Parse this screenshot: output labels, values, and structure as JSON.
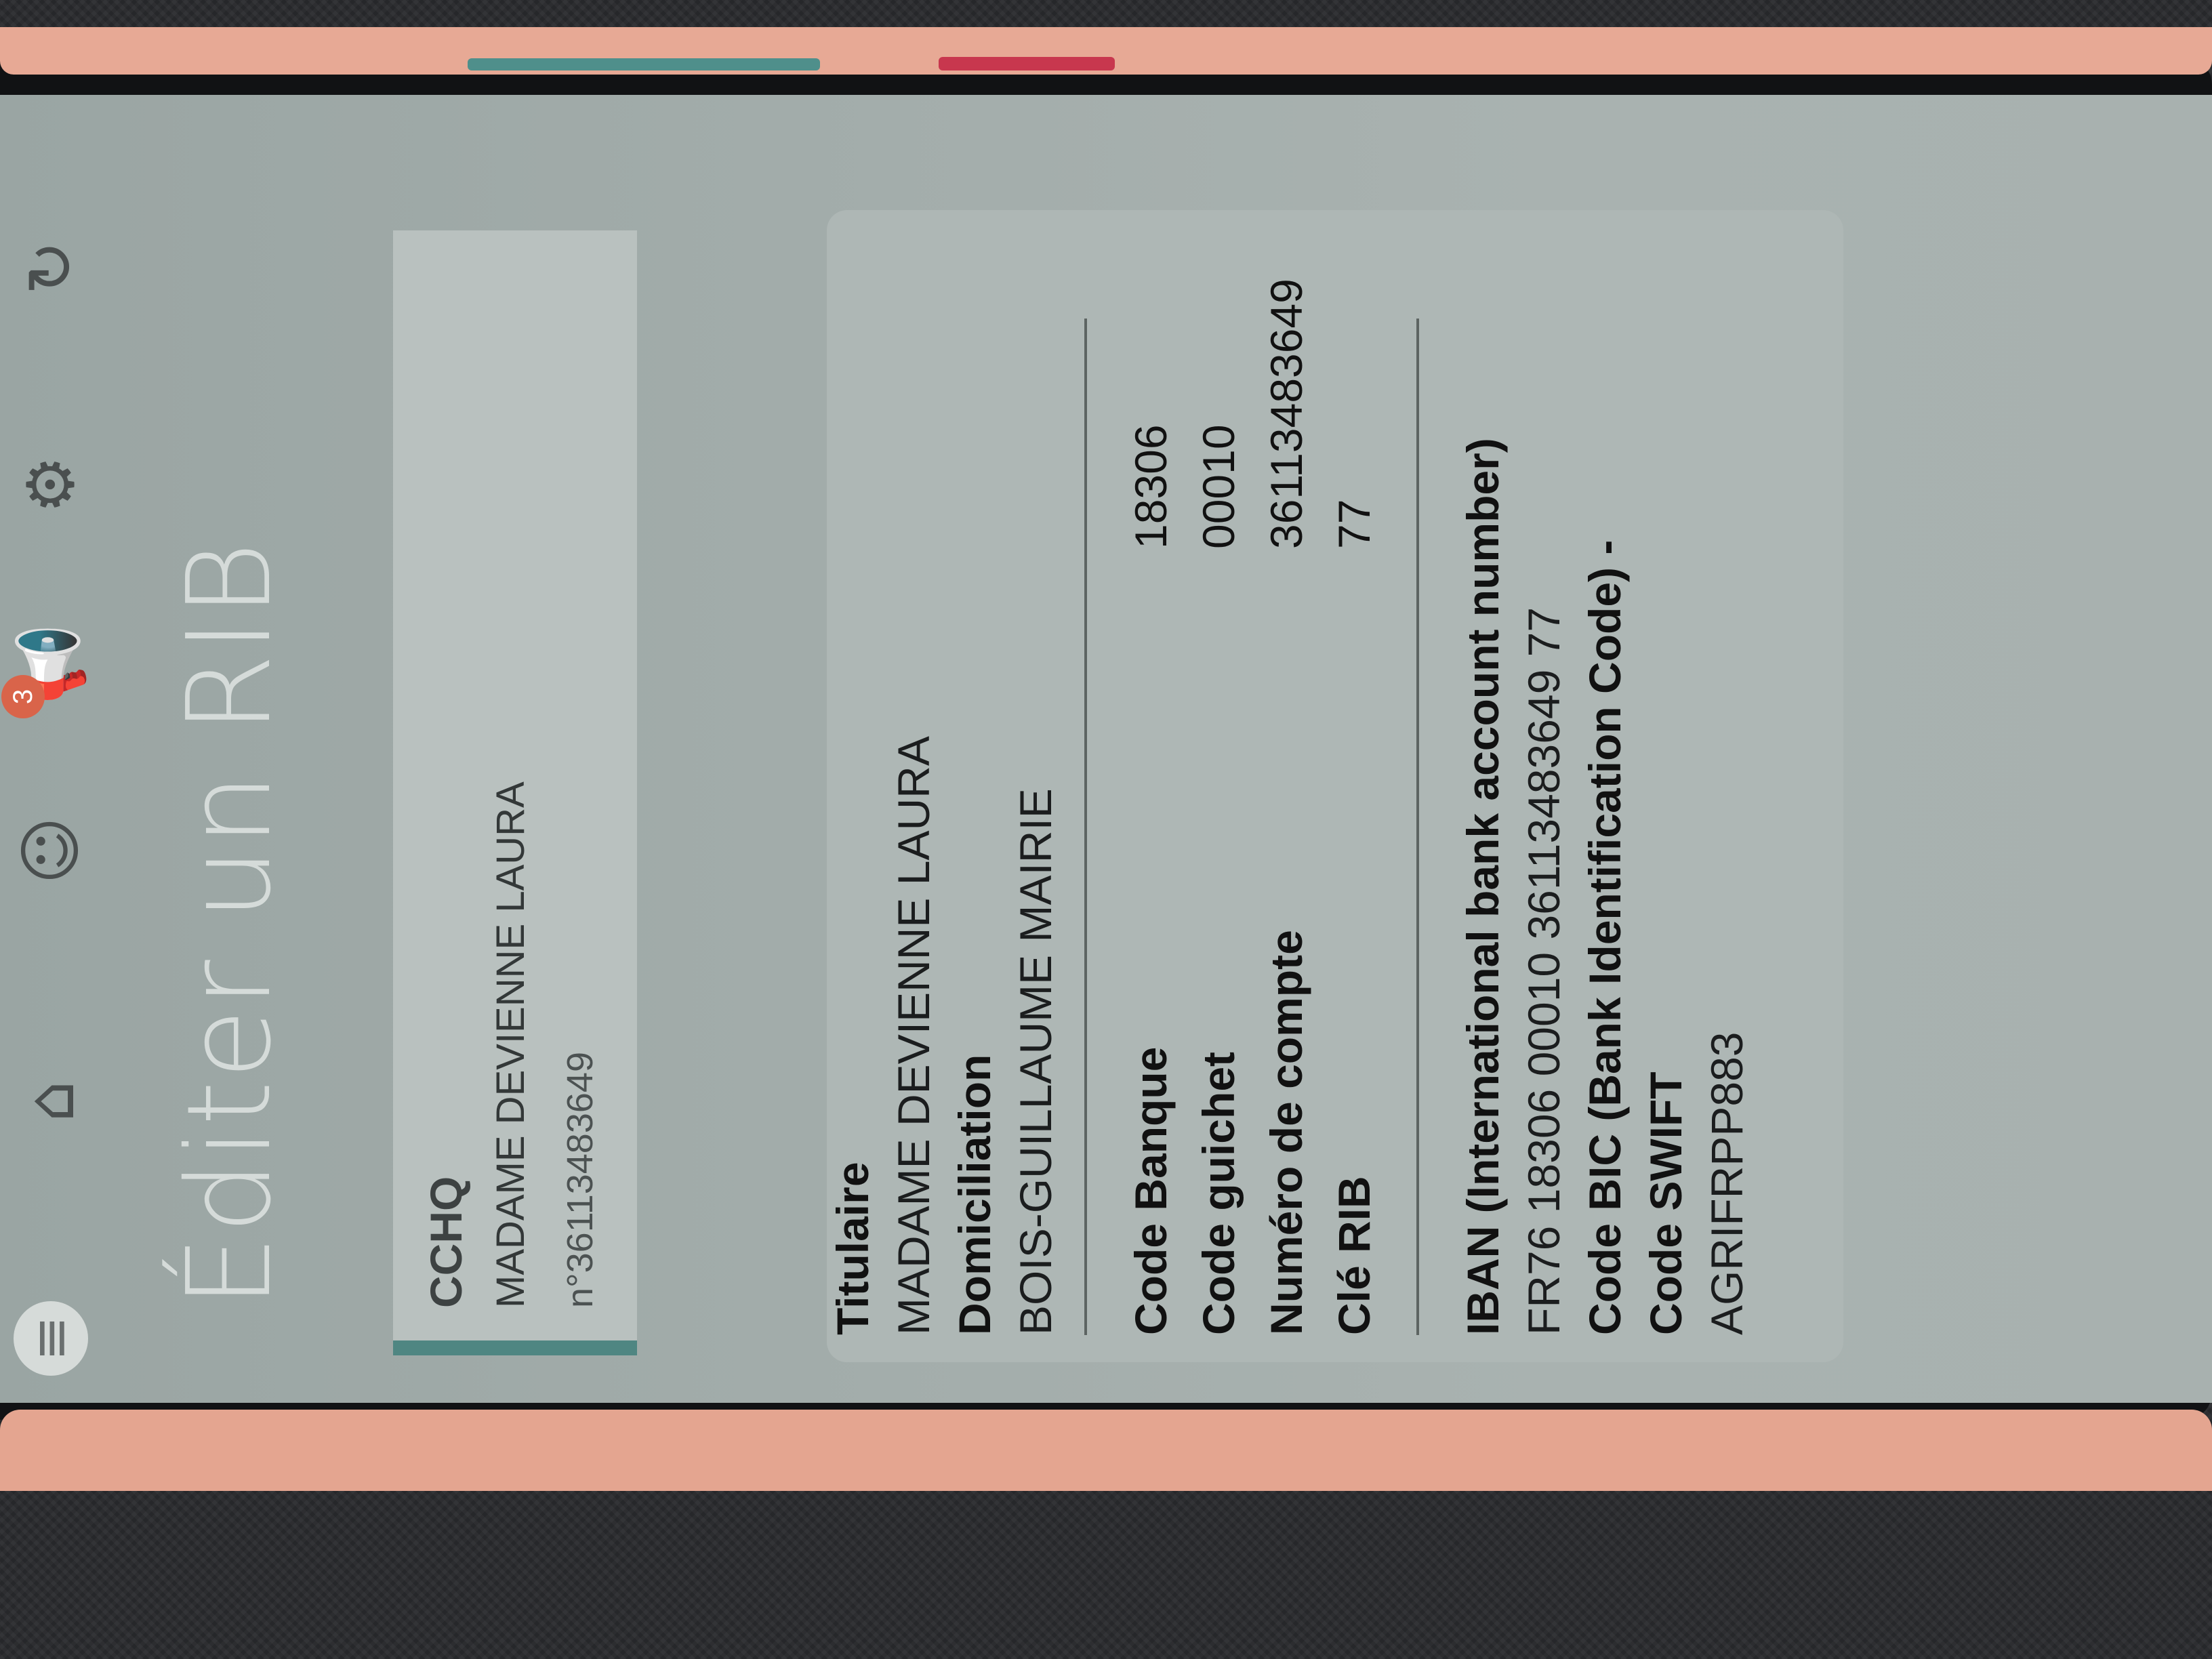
{
  "toolbar": {
    "icons": [
      "menu-icon",
      "home-icon",
      "chat-icon",
      "megaphone-icon",
      "gear-icon",
      "refresh-icon"
    ],
    "notification_badge": "3"
  },
  "page": {
    "title": "Éditer un RIB"
  },
  "account": {
    "type": "CCHQ",
    "holder": "MADAME DEVIENNE LAURA",
    "number": "n°36113483649"
  },
  "rib": {
    "titulaire_label": "Titulaire",
    "titulaire_value": "MADAME DEVIENNE LAURA",
    "domiciliation_label": "Domiciliation",
    "domiciliation_value": "BOIS-GUILLAUME MAIRIE",
    "code_banque_label": "Code Banque",
    "code_banque_value": "18306",
    "code_guichet_label": "Code guichet",
    "code_guichet_value": "00010",
    "numero_compte_label": "Numéro de compte",
    "numero_compte_value": "36113483649",
    "cle_rib_label": "Clé RIB",
    "cle_rib_value": "77",
    "iban_label": "IBAN (International bank account number)",
    "iban_value": "FR76 18306 00010 36113483649 77",
    "bic_label": "Code BIC (Bank Identification Code) -",
    "swift_label": "Code SWIFT",
    "swift_value": "AGRIFRPP883"
  },
  "colors": {
    "accent": "#4f8682",
    "badge": "#d9644a",
    "case": "#e7a995"
  }
}
